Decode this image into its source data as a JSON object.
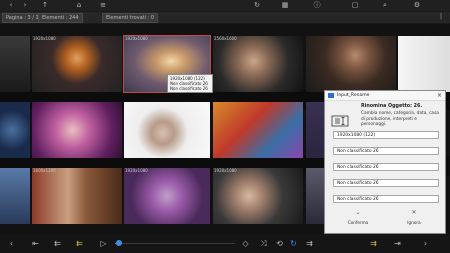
{
  "topbar": {
    "icons": [
      "back-icon",
      "forward-icon",
      "up-icon",
      "home-icon",
      "menu-icon",
      "refresh-icon",
      "windows-icon",
      "info-icon",
      "more-icon",
      "search-icon",
      "settings-icon"
    ]
  },
  "status": {
    "page": "Pagina : 3 / 16",
    "elements": "Elementi : 244",
    "found": "Elementi trovati : 0",
    "glyph_vbar": "|"
  },
  "tiles": {
    "label_1920": "1920x1080",
    "label_2560": "2560x1600",
    "label_1600": "1600x1200"
  },
  "tooltip": {
    "line1": "1920x1080 (122)",
    "line2": "Non classificato 26",
    "line3": "Non classificato 26"
  },
  "dialog": {
    "title": "Input_Rename",
    "close_glyph": "×",
    "header": "Rinomina Oggetto: 26.",
    "description": "Cambia nome, categoria, data, casa di produzione, interpreti e personaggi.",
    "fields": [
      "1920x1080 (122)",
      "Non classificato 26",
      "Non classificato 26",
      "Non classificato 26",
      "Non classificato 26"
    ],
    "confirm_label": "Conferma",
    "ignore_label": "Ignora",
    "confirm_glyph": "⌄",
    "ignore_glyph": "✕"
  },
  "bottombar": {
    "icons": [
      "back-icon",
      "first-page-icon",
      "prev-page-icon",
      "play-icon",
      "stop-icon",
      "shuffle-icon",
      "refresh-icon",
      "next-page-icon",
      "last-page-icon",
      "forward-icon"
    ],
    "glyphs": {
      "back": "‹",
      "first": "⇤",
      "prev": "⇇",
      "play": "▷",
      "view": "◇",
      "shuffle": "⤨",
      "rotate": "⟲",
      "refresh": "↻",
      "next": "⇉",
      "last": "⇥",
      "forward": "›"
    }
  },
  "slider": {
    "value": 0.03
  },
  "colors": {
    "accent": "#3a8ee6",
    "selection": "#c24a4a",
    "highlight": "#d6c13a"
  }
}
